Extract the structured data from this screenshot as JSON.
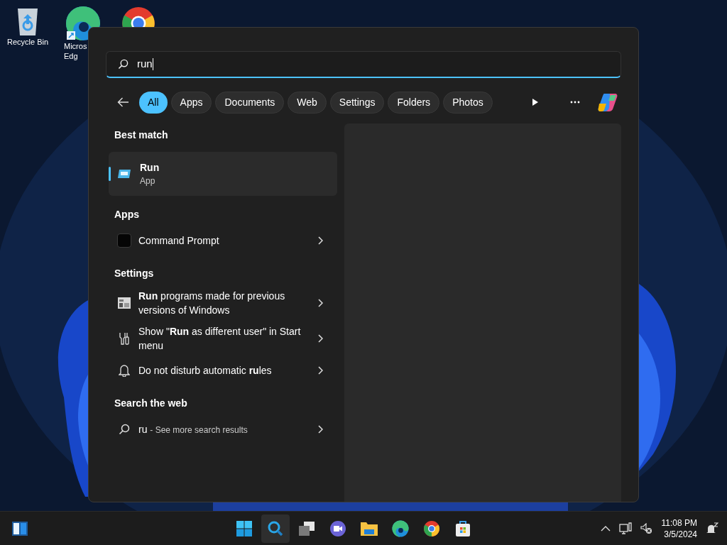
{
  "desktop_icons": [
    {
      "kind": "recycle",
      "lines": [
        "Recycle Bin"
      ]
    },
    {
      "kind": "edge",
      "lines": [
        "Micros",
        "Edg"
      ]
    },
    {
      "kind": "chrome"
    }
  ],
  "search": {
    "value": "run"
  },
  "filters": [
    {
      "label": "All",
      "selected": true
    },
    {
      "label": "Apps",
      "selected": false
    },
    {
      "label": "Documents",
      "selected": false
    },
    {
      "label": "Web",
      "selected": false
    },
    {
      "label": "Settings",
      "selected": false
    },
    {
      "label": "Folders",
      "selected": false
    },
    {
      "label": "Photos",
      "selected": false
    }
  ],
  "best_match": {
    "heading": "Best match",
    "title": "Run",
    "subtitle": "App",
    "selected": true
  },
  "sections": [
    {
      "heading": "Apps",
      "items": [
        {
          "kind": "cmd",
          "text": "Command Prompt"
        }
      ]
    },
    {
      "heading": "Settings",
      "items": [
        {
          "kind": "compat",
          "text": "**Run** programs made for previous versions of Windows"
        },
        {
          "kind": "tools",
          "text": "Show \"**Run** as different user\" in Start menu"
        },
        {
          "kind": "bell",
          "text": "Do not disturb automatic **ru**les"
        }
      ]
    },
    {
      "heading": "Search the web",
      "items": [
        {
          "kind": "web",
          "text": "ru",
          "hint": "- See more search results"
        }
      ]
    }
  ],
  "taskbar": {
    "apps": [
      {
        "kind": "start",
        "selected": false
      },
      {
        "kind": "search",
        "selected": true
      },
      {
        "kind": "taskview",
        "selected": false
      },
      {
        "kind": "meet",
        "selected": false
      },
      {
        "kind": "explorer",
        "selected": false
      },
      {
        "kind": "edge",
        "selected": false
      },
      {
        "kind": "chrome",
        "selected": false
      },
      {
        "kind": "store",
        "selected": false
      }
    ],
    "time": "11:08 PM",
    "date": "3/5/2024"
  }
}
